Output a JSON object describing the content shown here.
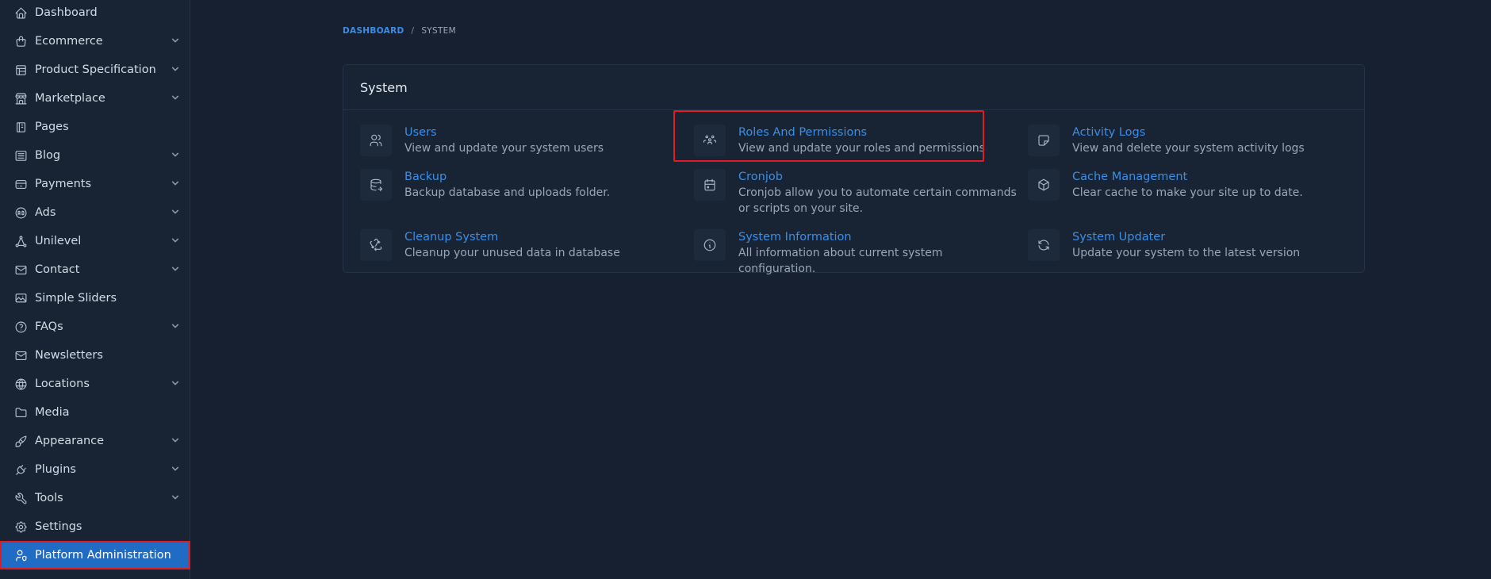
{
  "sidebar": {
    "items": [
      {
        "label": "Dashboard",
        "icon": "home-icon",
        "chevron": false
      },
      {
        "label": "Ecommerce",
        "icon": "shopping-bag-icon",
        "chevron": true
      },
      {
        "label": "Product Specification",
        "icon": "table-layout-icon",
        "chevron": true
      },
      {
        "label": "Marketplace",
        "icon": "building-store-icon",
        "chevron": true
      },
      {
        "label": "Pages",
        "icon": "notebook-icon",
        "chevron": false
      },
      {
        "label": "Blog",
        "icon": "article-icon",
        "chevron": true
      },
      {
        "label": "Payments",
        "icon": "credit-card-icon",
        "chevron": true
      },
      {
        "label": "Ads",
        "icon": "ad-circle-icon",
        "chevron": true
      },
      {
        "label": "Unilevel",
        "icon": "hierarchy-icon",
        "chevron": true
      },
      {
        "label": "Contact",
        "icon": "mail-icon",
        "chevron": true
      },
      {
        "label": "Simple Sliders",
        "icon": "slideshow-icon",
        "chevron": false
      },
      {
        "label": "FAQs",
        "icon": "help-circle-icon",
        "chevron": true
      },
      {
        "label": "Newsletters",
        "icon": "mail-icon",
        "chevron": false
      },
      {
        "label": "Locations",
        "icon": "world-icon",
        "chevron": true
      },
      {
        "label": "Media",
        "icon": "folder-icon",
        "chevron": false
      },
      {
        "label": "Appearance",
        "icon": "brush-icon",
        "chevron": true
      },
      {
        "label": "Plugins",
        "icon": "plug-icon",
        "chevron": true
      },
      {
        "label": "Tools",
        "icon": "tool-icon",
        "chevron": true
      },
      {
        "label": "Settings",
        "icon": "settings-icon",
        "chevron": false
      },
      {
        "label": "Platform Administration",
        "icon": "user-shield-icon",
        "chevron": false,
        "active": true
      }
    ]
  },
  "breadcrumb": {
    "root": "DASHBOARD",
    "separator": "/",
    "current": "SYSTEM"
  },
  "card": {
    "title": "System",
    "items": [
      {
        "title": "Users",
        "desc": "View and update your system users",
        "icon": "users-icon"
      },
      {
        "title": "Roles And Permissions",
        "desc": "View and update your roles and permissions",
        "icon": "user-group-icon"
      },
      {
        "title": "Activity Logs",
        "desc": "View and delete your system activity logs",
        "icon": "note-icon"
      },
      {
        "title": "Backup",
        "desc": "Backup database and uploads folder.",
        "icon": "database-export-icon"
      },
      {
        "title": "Cronjob",
        "desc": "Cronjob allow you to automate certain commands or scripts on your site.",
        "icon": "calendar-icon"
      },
      {
        "title": "Cache Management",
        "desc": "Clear cache to make your site up to date.",
        "icon": "box-icon"
      },
      {
        "title": "Cleanup System",
        "desc": "Cleanup your unused data in database",
        "icon": "recycle-icon"
      },
      {
        "title": "System Information",
        "desc": "All information about current system configuration.",
        "icon": "info-circle-icon"
      },
      {
        "title": "System Updater",
        "desc": "Update your system to the latest version",
        "icon": "refresh-icon"
      }
    ]
  },
  "colors": {
    "background": "#162030",
    "sidebar": "#182433",
    "accent": "#206bc4",
    "link": "#3b8ee8",
    "highlight": "#e01b24"
  }
}
